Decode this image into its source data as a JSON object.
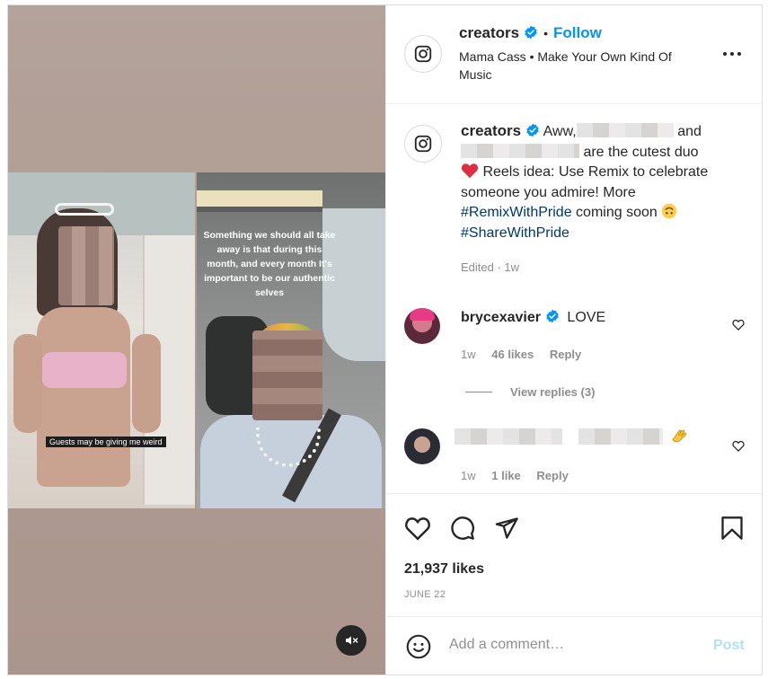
{
  "post": {
    "author": "creators",
    "follow_label": "Follow",
    "separator": "•",
    "audio": "Mama Cass • Make Your Own Kind Of Music",
    "more_icon": "more-horizontal-icon"
  },
  "media": {
    "overlay_text": "Something we should all take away is that during this month, and every month It's important to be our authentic selves",
    "left_caption": "Guests may be giving me weird",
    "mute_icon": "speaker-muted-icon"
  },
  "caption": {
    "author": "creators",
    "part1": "Aww,",
    "part2": "and",
    "part3": "are the cutest duo",
    "part4": "Reels idea: Use Remix to celebrate someone you admire! More",
    "hashtag1": "#RemixWithPride",
    "part5": "coming soon",
    "hashtag2": "#ShareWithPride",
    "edited": "Edited · 1w"
  },
  "comments": [
    {
      "author": "brycexavier",
      "text": "LOVE",
      "time": "1w",
      "likes": "46 likes",
      "reply": "Reply",
      "view_replies": "View replies (3)"
    },
    {
      "author": "",
      "time": "1w",
      "likes": "1 like",
      "reply": "Reply"
    }
  ],
  "actions": {
    "likes": "21,937 likes",
    "date": "JUNE 22"
  },
  "add_comment": {
    "placeholder": "Add a comment…",
    "post_label": "Post"
  },
  "colors": {
    "accent": "#0095f6",
    "hashtag": "#00376b",
    "muted": "#8e8e8e",
    "post_disabled": "#b2dffc"
  }
}
